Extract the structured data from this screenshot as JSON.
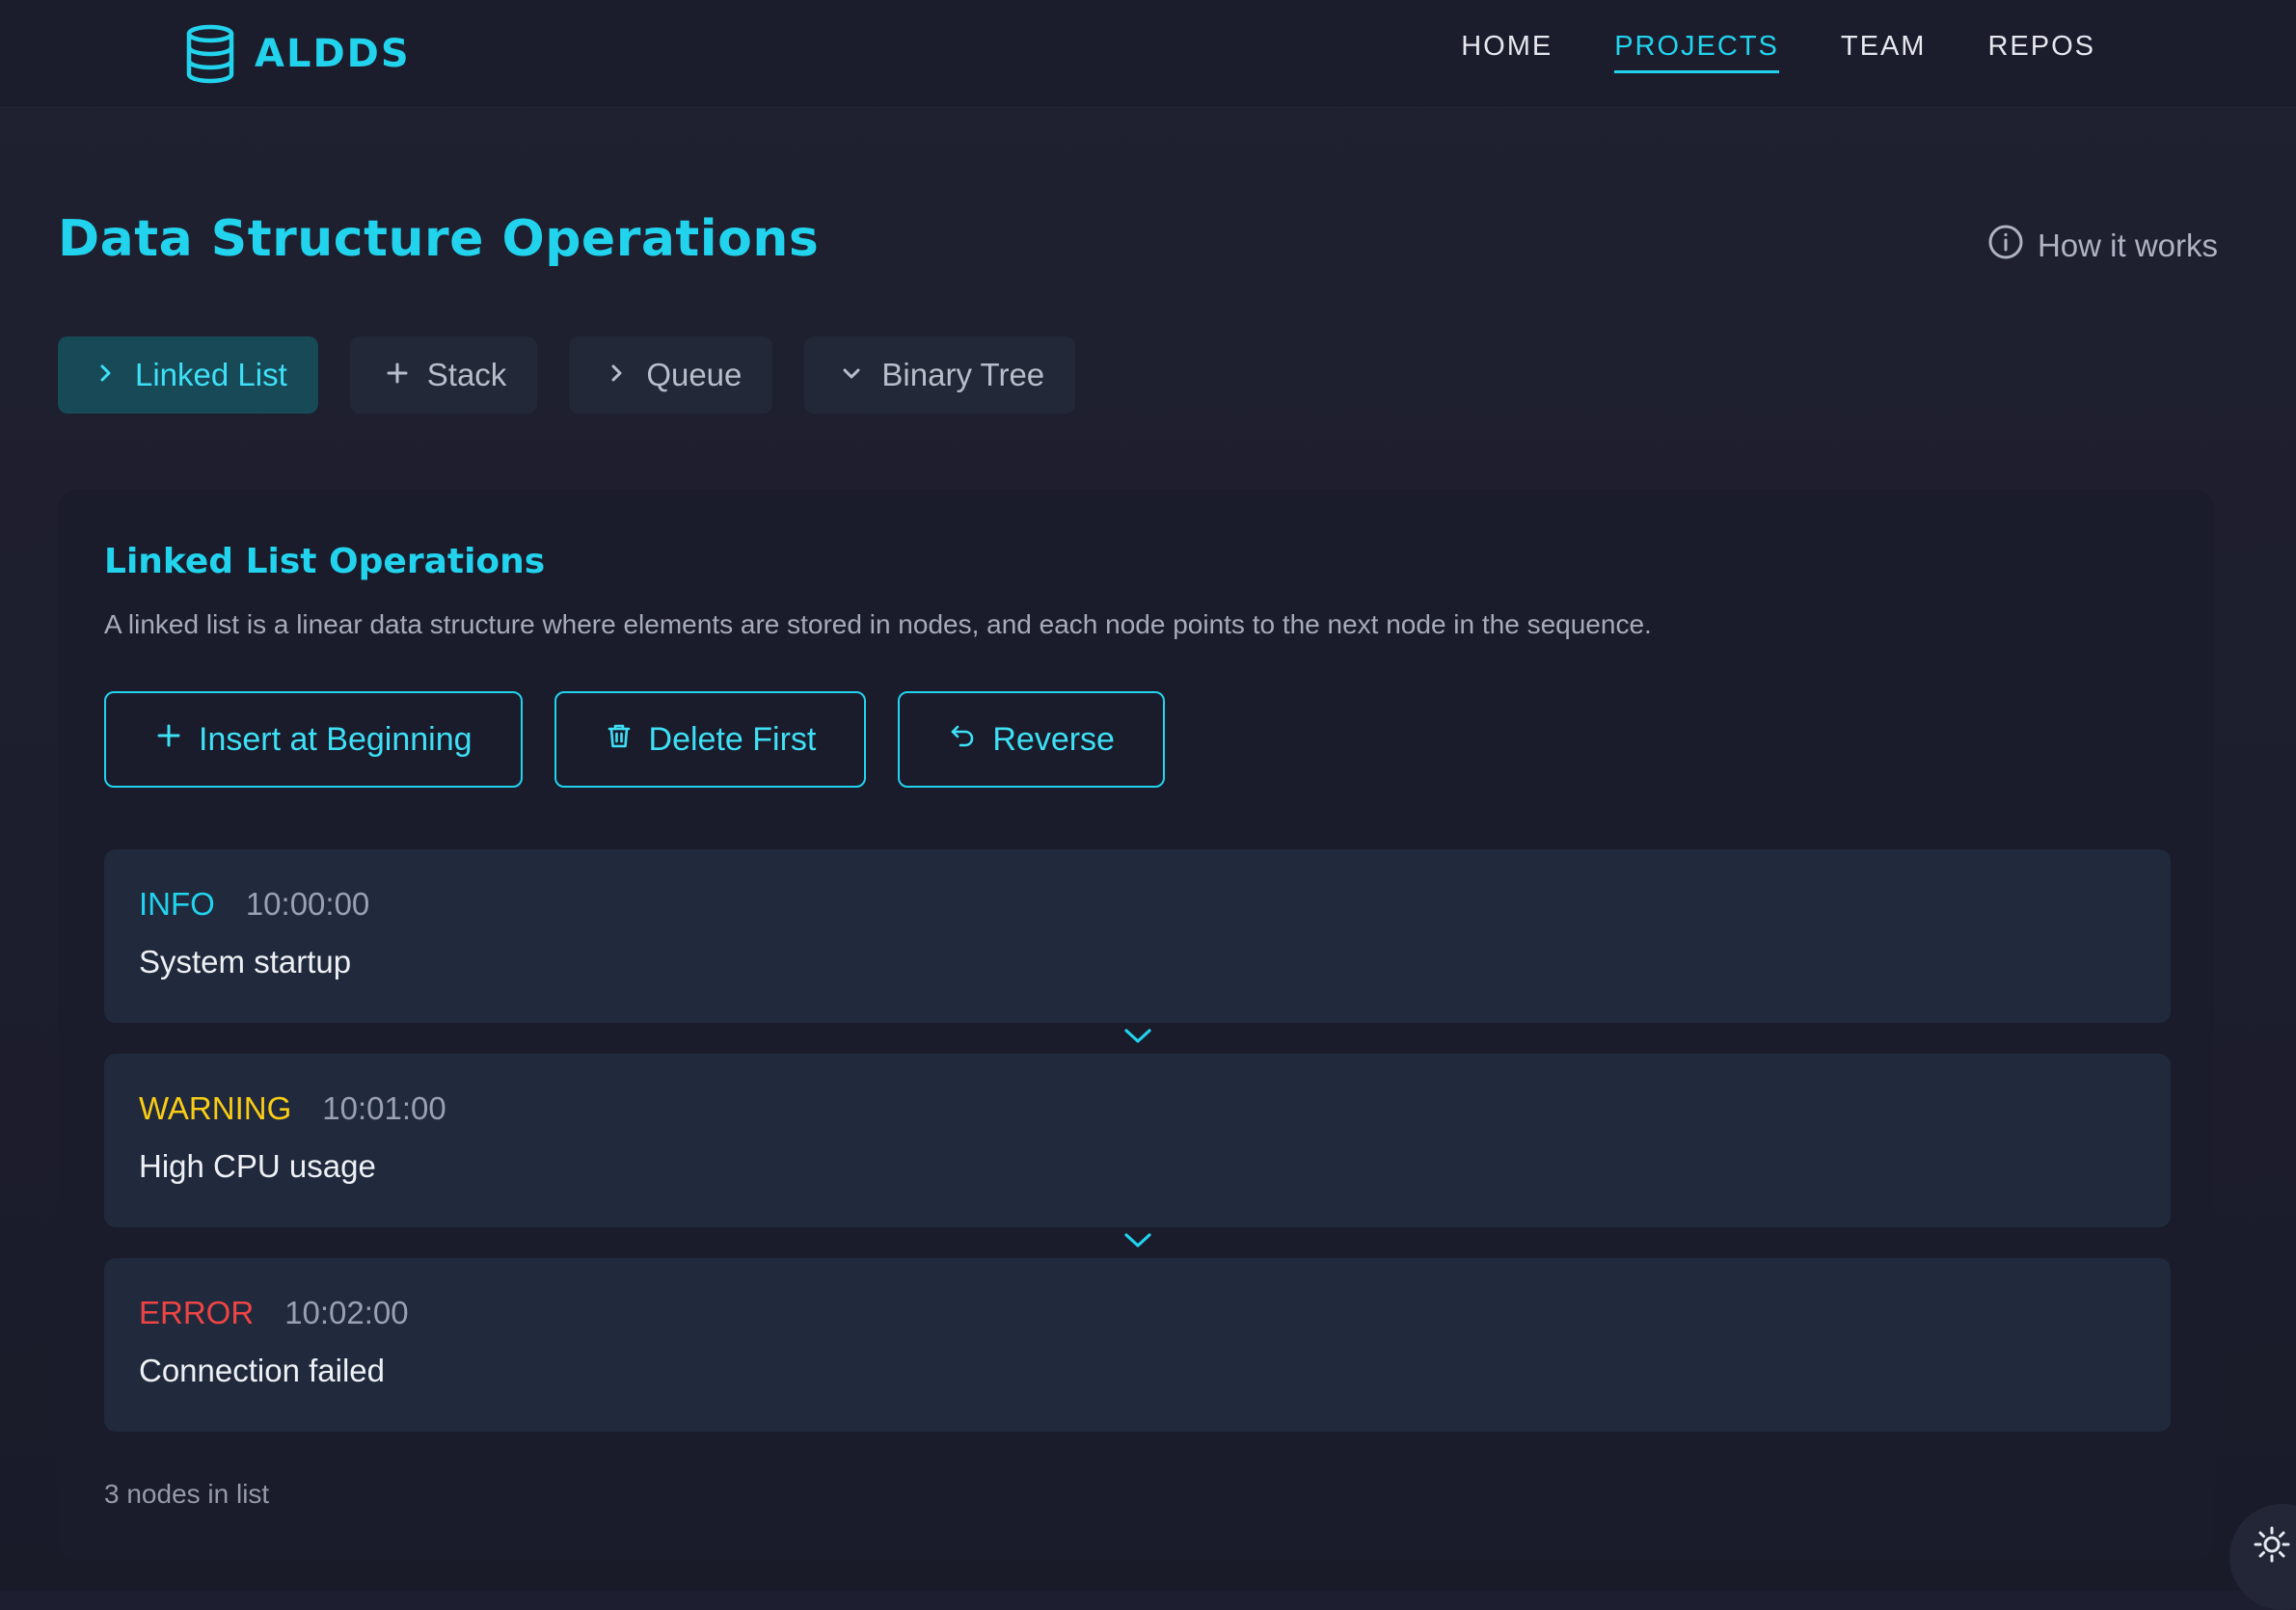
{
  "brand": {
    "name": "ALDDS",
    "icon": "database-icon"
  },
  "nav": {
    "items": [
      {
        "label": "HOME",
        "active": false
      },
      {
        "label": "PROJECTS",
        "active": true
      },
      {
        "label": "TEAM",
        "active": false
      },
      {
        "label": "REPOS",
        "active": false
      }
    ]
  },
  "header": {
    "title": "Data Structure Operations",
    "how_it_works": "How it works",
    "how_icon": "info-icon"
  },
  "tabs": [
    {
      "label": "Linked List",
      "icon": "chevron-right-icon",
      "active": true
    },
    {
      "label": "Stack",
      "icon": "plus-icon",
      "active": false
    },
    {
      "label": "Queue",
      "icon": "chevron-right-icon",
      "active": false
    },
    {
      "label": "Binary Tree",
      "icon": "chevron-down-icon",
      "active": false
    }
  ],
  "panel": {
    "title": "Linked List Operations",
    "description": "A linked list is a linear data structure where elements are stored in nodes, and each node points to the next node in the sequence.",
    "actions": [
      {
        "label": "Insert at Beginning",
        "icon": "plus-icon"
      },
      {
        "label": "Delete First",
        "icon": "trash-icon"
      },
      {
        "label": "Reverse",
        "icon": "undo-icon"
      }
    ],
    "nodes": [
      {
        "level": "INFO",
        "time": "10:00:00",
        "message": "System startup"
      },
      {
        "level": "WARNING",
        "time": "10:01:00",
        "message": "High CPU usage"
      },
      {
        "level": "ERROR",
        "time": "10:02:00",
        "message": "Connection failed"
      }
    ],
    "count_text": "3 nodes in list"
  },
  "theme_toggle": {
    "icon": "sun-icon"
  },
  "colors": {
    "accent": "#22d3ee",
    "warning": "#facc15",
    "error": "#ef4444",
    "background": "#1d1e2f",
    "node_bg": "#202a3c"
  }
}
